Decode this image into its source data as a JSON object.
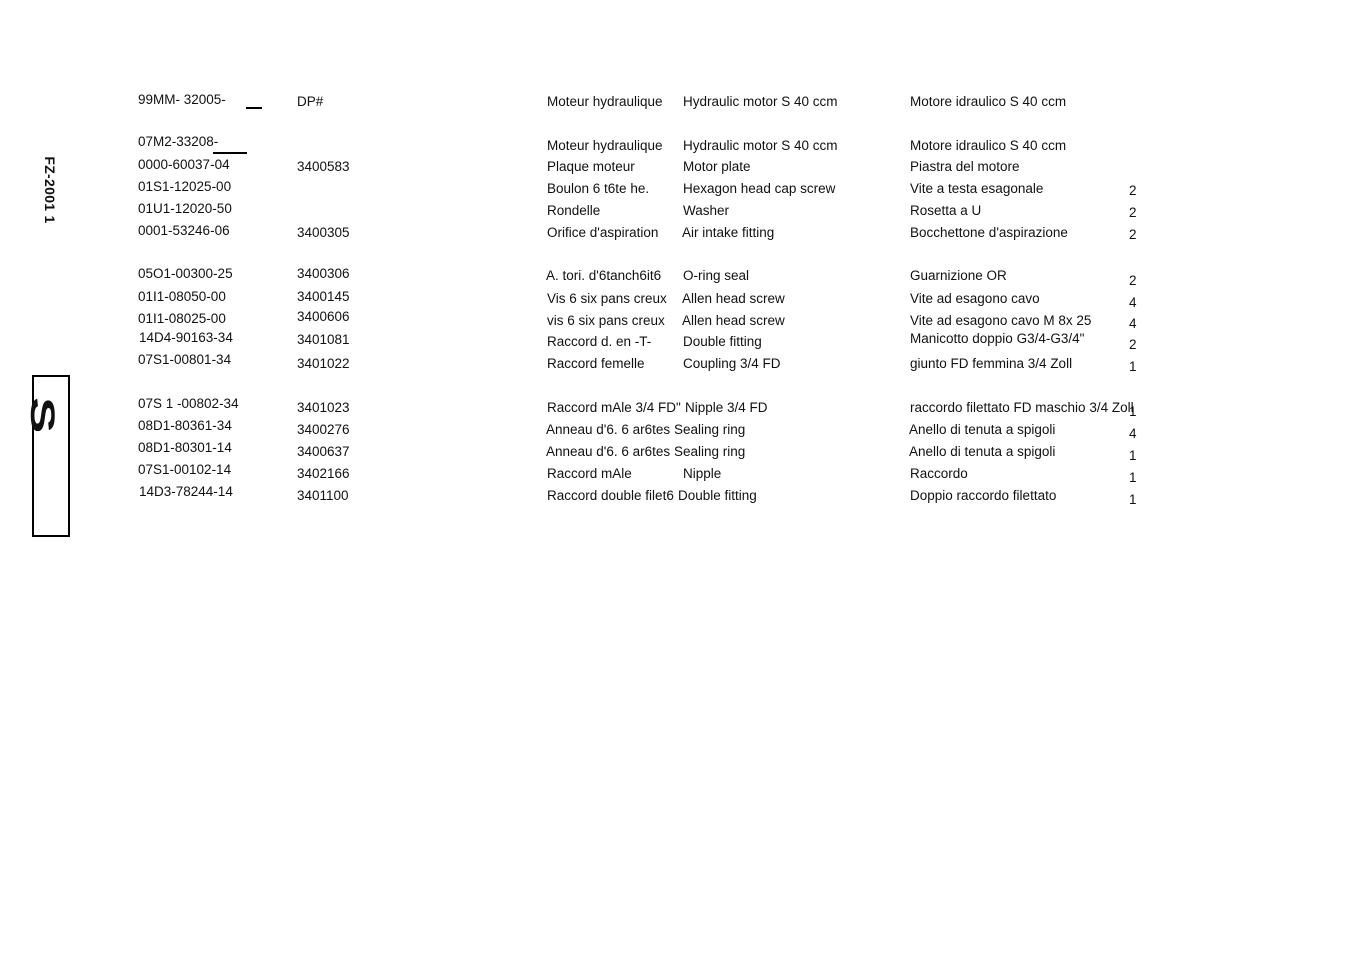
{
  "side_label": "FZ-2001 1",
  "side_box_glyph": "S",
  "header_row": {
    "part_no": "99MM- 32005-",
    "dp": "DP#",
    "fr": "Moteur hydraulique",
    "en": "Hydraulic motor S 40 ccm",
    "it": "Motore idraulico S 40 ccm",
    "qty": ""
  },
  "rows": [
    {
      "part_no": "07M2-33208-",
      "dp": "",
      "fr": "Moteur hydraulique",
      "en": "Hydraulic motor S 40 ccm",
      "it": "Motore idraulico S 40 ccm",
      "qty": ""
    },
    {
      "part_no": "0000-60037-04",
      "dp": "3400583",
      "fr": "Plaque moteur",
      "en": "Motor plate",
      "it": "Piastra del motore",
      "qty": ""
    },
    {
      "part_no": "01S1-12025-00",
      "dp": "",
      "fr": "Boulon 6 t6te he.",
      "en": "Hexagon head cap screw",
      "it": "Vite a testa esagonale",
      "qty": "2"
    },
    {
      "part_no": "01U1-12020-50",
      "dp": "",
      "fr": "Rondelle",
      "en": "Washer",
      "it": "Rosetta a U",
      "qty": "2"
    },
    {
      "part_no": "0001-53246-06",
      "dp": "3400305",
      "fr": "Orifice d'aspiration",
      "en": "Air intake fitting",
      "it": "Bocchettone d'aspirazione",
      "qty": "2"
    },
    {
      "part_no": "05O1-00300-25",
      "dp": "3400306",
      "fr": "A. tori. d'6tanch6it6",
      "en": "O-ring seal",
      "it": "Guarnizione OR",
      "qty": "2"
    },
    {
      "part_no": "01I1-08050-00",
      "dp": "3400145",
      "fr": "Vis 6 six pans creux",
      "en": "Allen head screw",
      "it": "Vite ad esagono cavo",
      "qty": "4"
    },
    {
      "part_no": "01I1-08025-00",
      "dp": "3400606",
      "fr": "vis 6 six pans creux",
      "en": "Allen head screw",
      "it": "Vite ad esagono cavo M 8x 25",
      "qty": "4"
    },
    {
      "part_no": "14D4-90163-34",
      "dp": "3401081",
      "fr": "Raccord d. en -T-",
      "en": "Double fitting",
      "it": "Manicotto doppio G3/4-G3/4\"",
      "qty": "2"
    },
    {
      "part_no": "07S1-00801-34",
      "dp": "3401022",
      "fr": "Raccord femelle",
      "en": "Coupling 3/4 FD",
      "it": "giunto FD femmina 3/4 Zoll",
      "qty": "1"
    },
    {
      "part_no": "07S 1 -00802-34",
      "dp": "3401023",
      "fr": "Raccord mAle 3/4 FD\"",
      "en": "Nipple 3/4 FD",
      "it": "raccordo filettato FD maschio 3/4 Zoll",
      "qty": "1"
    },
    {
      "part_no": "08D1-80361-34",
      "dp": "3400276",
      "fr": "Anneau d'6. 6 ar6tes",
      "en": "Sealing ring",
      "it": "Anello di tenuta a spigoli",
      "qty": "4"
    },
    {
      "part_no": "08D1-80301-14",
      "dp": "3400637",
      "fr": "Anneau d'6. 6 ar6tes",
      "en": "Sealing ring",
      "it": "Anello di tenuta a spigoli",
      "qty": "1"
    },
    {
      "part_no": "07S1-00102-14",
      "dp": "3402166",
      "fr": "Raccord mAle",
      "en": "Nipple",
      "it": "Raccordo",
      "qty": "1"
    },
    {
      "part_no": "14D3-78244-14",
      "dp": "3401100",
      "fr": "Raccord double filet6",
      "en": "Double fitting",
      "it": "Doppio raccordo filettato",
      "qty": "1"
    }
  ]
}
